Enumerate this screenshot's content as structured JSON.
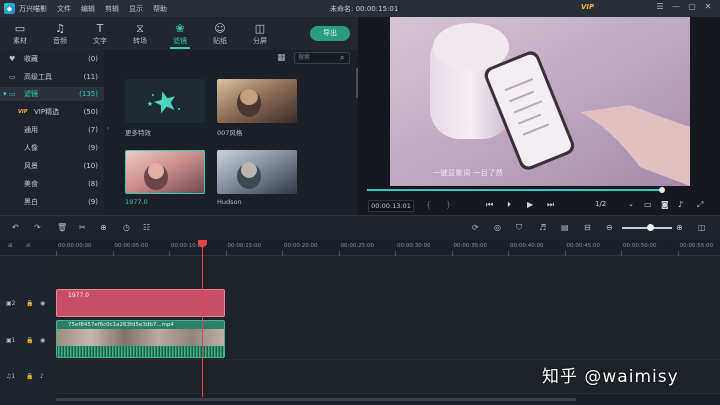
{
  "titlebar": {
    "app_name": "万兴喵影",
    "menu": [
      "文件",
      "编辑",
      "剪辑",
      "显示",
      "帮助"
    ],
    "window_title": "未命名: 00:00:15:01",
    "vip_label": "VIP",
    "controls": [
      "☰",
      "—",
      "▢",
      "✕"
    ]
  },
  "toolbar": {
    "tools": [
      {
        "label": "素材",
        "icon": "folder-icon"
      },
      {
        "label": "音频",
        "icon": "music-note-icon"
      },
      {
        "label": "文字",
        "icon": "text-icon"
      },
      {
        "label": "转场",
        "icon": "transition-icon"
      },
      {
        "label": "滤镜",
        "icon": "filter-icon"
      },
      {
        "label": "贴纸",
        "icon": "sticker-icon"
      },
      {
        "label": "分屏",
        "icon": "split-screen-icon"
      }
    ],
    "active_tool": "滤镜",
    "export_label": "导出"
  },
  "sidebar": {
    "items": [
      {
        "label": "收藏",
        "count": "(0)",
        "icon": "heart-icon"
      },
      {
        "label": "高级工具",
        "count": "(11)",
        "icon": "folder-icon"
      },
      {
        "label": "滤镜",
        "count": "(135)",
        "icon": "folder-open-icon",
        "active": true
      },
      {
        "label": "VIP精选",
        "count": "(50)",
        "vip": true
      },
      {
        "label": "通用",
        "count": "(7)"
      },
      {
        "label": "人像",
        "count": "(9)"
      },
      {
        "label": "风景",
        "count": "(10)"
      },
      {
        "label": "美食",
        "count": "(8)"
      },
      {
        "label": "黑白",
        "count": "(9)"
      }
    ],
    "vip_tag": "VIP"
  },
  "library": {
    "search_placeholder": "搜索",
    "cards": [
      {
        "label": "更多特效"
      },
      {
        "label": "007风格"
      },
      {
        "label": "1977.0",
        "selected": true
      },
      {
        "label": "Hudson"
      }
    ]
  },
  "preview": {
    "subtitle": "一键显歌词 一目了然",
    "timecode": "00:00:13:01",
    "page": "1/2",
    "progress_fraction": 0.99
  },
  "timeline": {
    "ruler_ticks": [
      "00:00:00:00",
      "00:00:05:00",
      "00:00:10:00",
      "00:00:15:00",
      "00:00:20:00",
      "00:00:25:00",
      "00:00:30:00",
      "00:00:35:00",
      "00:00:40:00",
      "00:00:45:00",
      "00:00:50:00",
      "00:00:55:00"
    ],
    "track_labels": [
      "2",
      "1",
      "1"
    ],
    "filter_clip_label": "1977.0",
    "video_clip_label": "75ef8457ef6c0c1a263fd5e3db7...mp4"
  },
  "watermark": "知乎 @waimisy"
}
